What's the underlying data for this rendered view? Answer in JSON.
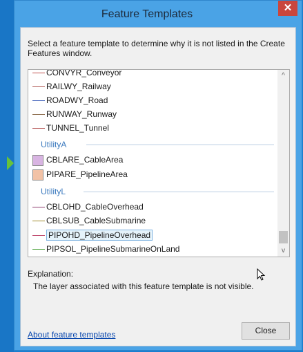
{
  "window": {
    "title": "Feature Templates",
    "close_glyph": "✕"
  },
  "instruction": "Select a feature template to determine why it is not listed in the Create Features window.",
  "list": {
    "line_items_top": [
      {
        "label": "CONVYR_Conveyor",
        "color": "#c0504d"
      },
      {
        "label": "RAILWY_Railway",
        "color": "#b05a54"
      },
      {
        "label": "ROADWY_Road",
        "color": "#4f6ec0"
      },
      {
        "label": "RUNWAY_Runway",
        "color": "#8b6b4a"
      },
      {
        "label": "TUNNEL_Tunnel",
        "color": "#b04a4a"
      }
    ],
    "groups": {
      "utility_a": "UtilityA",
      "utility_l": "UtilityL"
    },
    "area_items": [
      {
        "label": "CBLARE_CableArea",
        "color": "#d8b4e2"
      },
      {
        "label": "PIPARE_PipelineArea",
        "color": "#f2c2a6"
      }
    ],
    "line_items_bottom": [
      {
        "label": "CBLOHD_CableOverhead",
        "color": "#8e3b6e"
      },
      {
        "label": "CBLSUB_CableSubmarine",
        "color": "#a08a2a"
      },
      {
        "label": "PIPOHD_PipelineOverhead",
        "color": "#c04a6e"
      },
      {
        "label": "PIPSOL_PipelineSubmarineOnLand",
        "color": "#59a84a"
      }
    ],
    "scroll_up_glyph": "^",
    "scroll_down_glyph": "v"
  },
  "explanation": {
    "label": "Explanation:",
    "text": "The layer associated with this feature template is not visible."
  },
  "footer": {
    "about_link": "About feature templates",
    "close_button": "Close"
  }
}
